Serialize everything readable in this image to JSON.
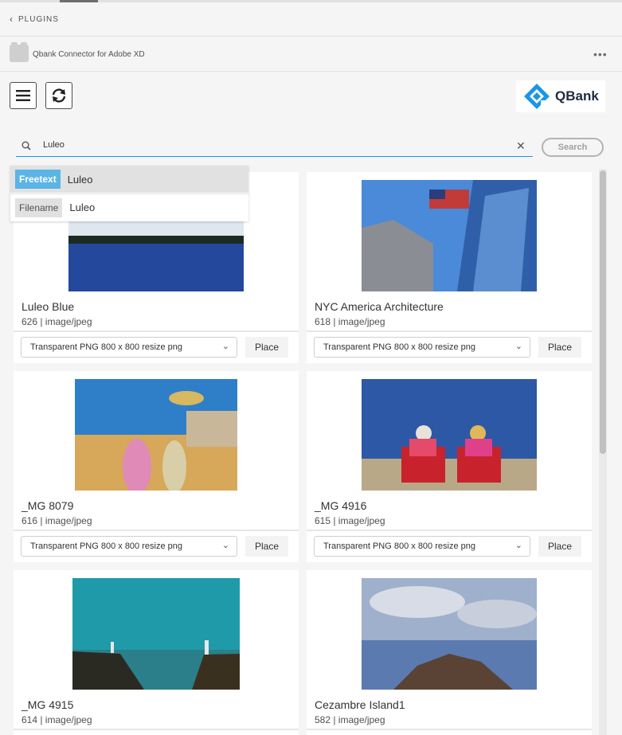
{
  "nav": {
    "back_label": "PLUGINS"
  },
  "plugin": {
    "name": "Qbank Connector for Adobe XD",
    "more": "•••"
  },
  "logo": {
    "text": "QBank",
    "accent": "#1a96e6"
  },
  "search": {
    "value": "Luleo",
    "clear": "✕",
    "button_label": "Search"
  },
  "suggestions": [
    {
      "chip": "Freetext",
      "text": "Luleo"
    },
    {
      "chip": "Filename",
      "text": "Luleo"
    }
  ],
  "cards": [
    {
      "title": "Luleo Blue",
      "meta": "626 | image/jpeg",
      "format": "Transparent PNG 800 x 800 resize png",
      "place": "Place"
    },
    {
      "title": "NYC America Architecture",
      "meta": "618 | image/jpeg",
      "format": "Transparent PNG 800 x 800 resize png",
      "place": "Place"
    },
    {
      "title": "_MG 8079",
      "meta": "616 | image/jpeg",
      "format": "Transparent PNG 800 x 800 resize png",
      "place": "Place"
    },
    {
      "title": "_MG 4916",
      "meta": "615 | image/jpeg",
      "format": "Transparent PNG 800 x 800 resize png",
      "place": "Place"
    },
    {
      "title": "_MG 4915",
      "meta": "614 | image/jpeg",
      "format": "Transparent PNG 800 x 800 resize png",
      "place": "Place"
    },
    {
      "title": "Cezambre Island1",
      "meta": "582 | image/jpeg",
      "format": "Transparent PNG 800 x 800 resize png",
      "place": "Place"
    }
  ]
}
